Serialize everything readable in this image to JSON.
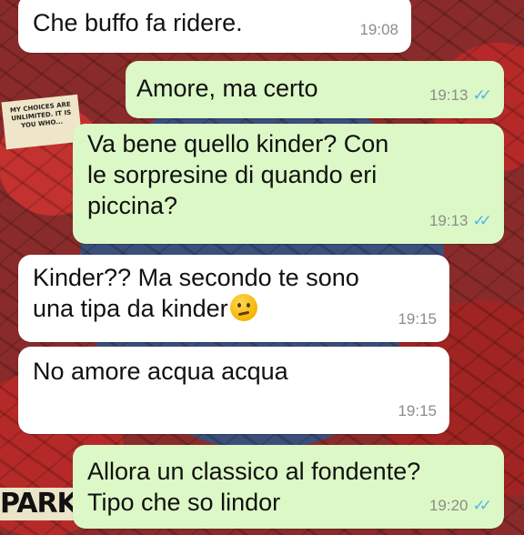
{
  "wallpaper": {
    "caption": "MY CHOICES ARE UNLIMITED. IT IS YOU WHO...",
    "park_text": "PARKI"
  },
  "messages": [
    {
      "direction": "in",
      "lines": [
        "Che buffo fa ridere."
      ],
      "time": "19:08",
      "read": false
    },
    {
      "direction": "out",
      "lines": [
        "Amore, ma certo"
      ],
      "time": "19:13",
      "read": true
    },
    {
      "direction": "out",
      "lines": [
        "Va bene quello kinder? Con",
        "le sorpresine di quando eri",
        "piccina?"
      ],
      "time": "19:13",
      "read": true
    },
    {
      "direction": "in",
      "lines": [
        "Kinder?? Ma secondo te sono",
        "una tipa da kinder"
      ],
      "emoji": "thinking-face",
      "time": "19:15",
      "read": false
    },
    {
      "direction": "in",
      "lines": [
        "No amore acqua acqua"
      ],
      "time": "19:15",
      "read": false
    },
    {
      "direction": "out",
      "lines": [
        "Allora un classico al fondente?",
        "Tipo che so lindor"
      ],
      "time": "19:20",
      "read": true
    }
  ],
  "colors": {
    "incoming_bubble": "#ffffff",
    "outgoing_bubble": "#dcf8c6",
    "read_ticks": "#4fb6ec",
    "timestamp": "#8c8c8c"
  },
  "icons": {
    "read_receipt": "double-check-icon",
    "emoji": "thinking-face-emoji"
  }
}
